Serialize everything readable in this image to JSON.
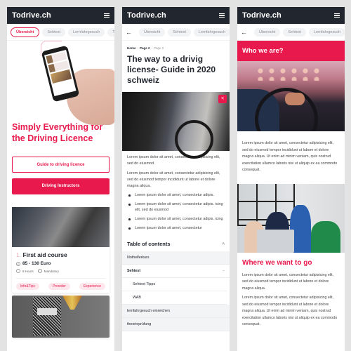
{
  "brand": {
    "name": "Todrive.ch",
    "accent_color": "#e8194c",
    "header_color": "#22262f"
  },
  "screen1": {
    "tabs": [
      "Übersicht",
      "Sehtest",
      "Lernfahrgesuch",
      "The"
    ],
    "active_tab": "Übersicht",
    "headline": "Simply Everything for the Driving Licence",
    "buttons": {
      "guide": "Guide to driving licence",
      "instructors": "Driving Instructors"
    },
    "card": {
      "number": "1.",
      "title": "First aid course",
      "price": "85 - 130 Euro",
      "duration": "8 Hours",
      "requirement": "Mandatory",
      "chips": [
        "Info&Tips",
        "Provider",
        "Experience"
      ]
    }
  },
  "screen2": {
    "tabs": [
      "Übersicht",
      "Sehtest",
      "Lernfahrgesuch"
    ],
    "breadcrumb": [
      "Home",
      "Page 2",
      "Page 2"
    ],
    "title": "The way to a drivig license- Guide in 2020 schweiz",
    "paragraphs": [
      "Lorem ipsum dolor sit amet, consectetur adipisicing elit, sed do eiusmod.",
      "Lorem ipsum dolor sit amet, consectetur adipisicing elit, sed do eiusmod tempor incididunt ut labore et dolore magna aliqua."
    ],
    "bullets": [
      "Lorem ipsum dolor sit amet, consectetur adipis.",
      "Lorem ipsum dolor sit amet, consectetur adipis. icing elit, sed do eiusmod",
      "Lorem ipsum dolor sit amet, consectetur adipis. icing",
      "Lorem ipsum dolor sit amet, consectetur"
    ],
    "toc": {
      "heading": "Table of contents",
      "items": [
        {
          "label": "Nothelferkurs"
        },
        {
          "label": "Sehtest",
          "expanded": true
        },
        {
          "label": "Sehtest Tipps",
          "sub": true
        },
        {
          "label": "WAB",
          "sub": true
        },
        {
          "label": "lernfahrgesuch einreichen"
        },
        {
          "label": "theorieprüfung"
        }
      ]
    }
  },
  "screen3": {
    "tabs": [
      "Übersicht",
      "Sehtest",
      "Lernfahrgesuch"
    ],
    "who_title": "Who we are?",
    "who_text": "Lorem ipsum dolor sit amet, consectetur adipisicing elit, sed do eiusmod tempor incididunt ut labore et dolore magna aliqua. Ut enim ad minim veniam, quis nostrud exercitation ullamco laboris nisi ut aliquip ex ea commodo consequat.",
    "where_title": "Where we want to go",
    "where_paragraphs": [
      "Lorem ipsum dolor sit amet, consectetur adipisicing elit, sed do eiusmod tempor incididunt ut labore et dolore magna aliqua.",
      "Lorem ipsum dolor sit amet, consectetur adipisicing elit, sed do eiusmod tempor incididunt ut labore et dolore magna aliqua. Ut enim ad minim veniam, quis nostrud exercitation ullamco laboris nisi ut aliquip ex ea commodo consequat."
    ]
  },
  "icons": {
    "menu": "hamburger-icon",
    "back": "←",
    "share": "share-icon",
    "chevron_up": "˄",
    "minus": "–",
    "price": "€",
    "clock": "◷",
    "info": "i"
  }
}
